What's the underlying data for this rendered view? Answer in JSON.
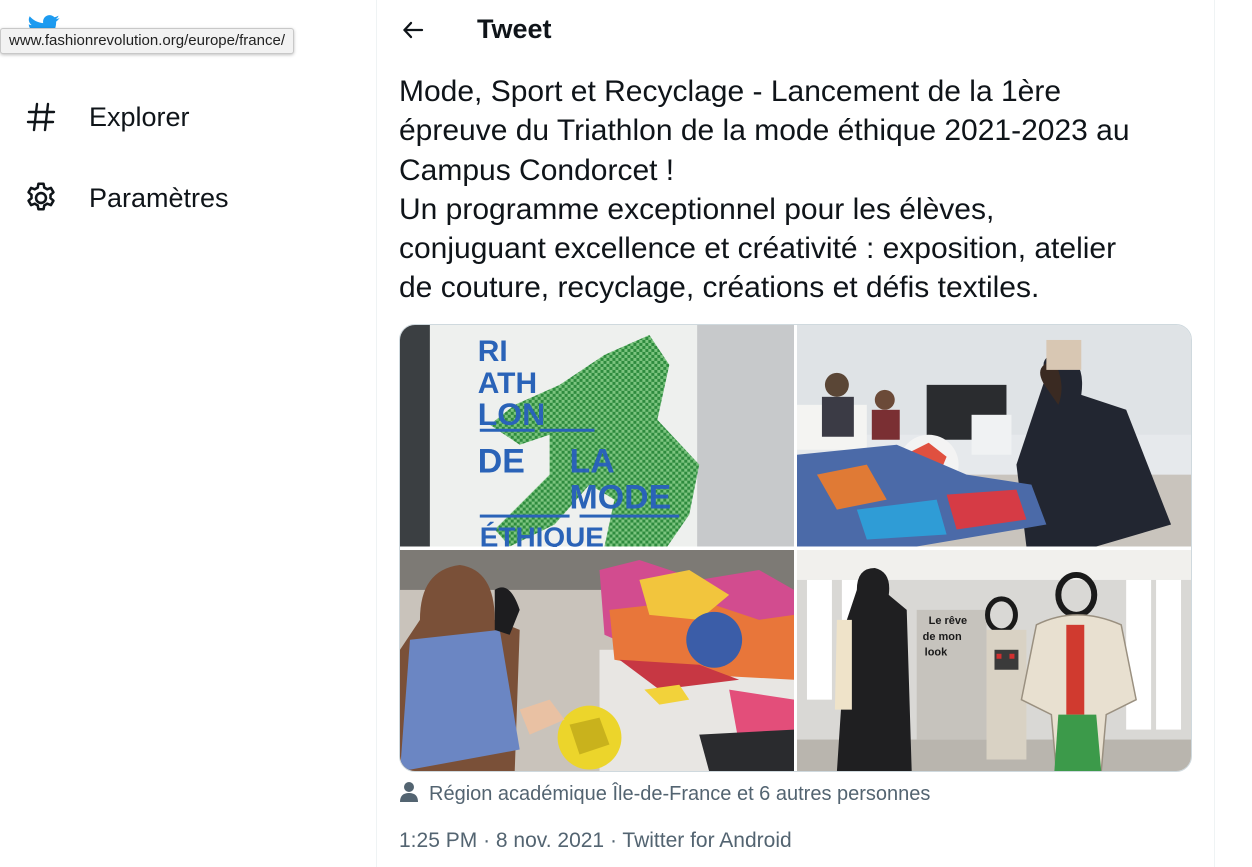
{
  "browser": {
    "status_url": "www.fashionrevolution.org/europe/france/"
  },
  "sidebar": {
    "items": [
      {
        "label": "Explorer",
        "icon": "hashtag-icon"
      },
      {
        "label": "Paramètres",
        "icon": "gear-icon"
      }
    ]
  },
  "header": {
    "title": "Tweet"
  },
  "tweet": {
    "text_lines": [
      "Mode, Sport et Recyclage - Lancement de la 1ère",
      "épreuve du Triathlon de la mode éthique 2021-2023 au",
      "Campus Condorcet !",
      "Un programme exceptionnel pour les élèves,",
      "conjuguant excellence et créativité : exposition, atelier",
      "de couture, recyclage, créations et défis textiles."
    ],
    "poster_words": [
      "RI",
      "ATH",
      "LON",
      "DE",
      "LA",
      "MODE",
      "ÉTHIQUE"
    ],
    "sign_text": [
      "Le rêve",
      "de mon",
      "look"
    ],
    "tagged_people": "Région académique Île-de-France et 6 autres personnes",
    "time": "1:25 PM",
    "date": "8 nov. 2021",
    "source": "Twitter for Android",
    "separator": "·"
  },
  "colors": {
    "brand_blue": "#1d9bf0",
    "text_primary": "#0f1419",
    "text_secondary": "#536471",
    "border": "#eff3f4"
  }
}
